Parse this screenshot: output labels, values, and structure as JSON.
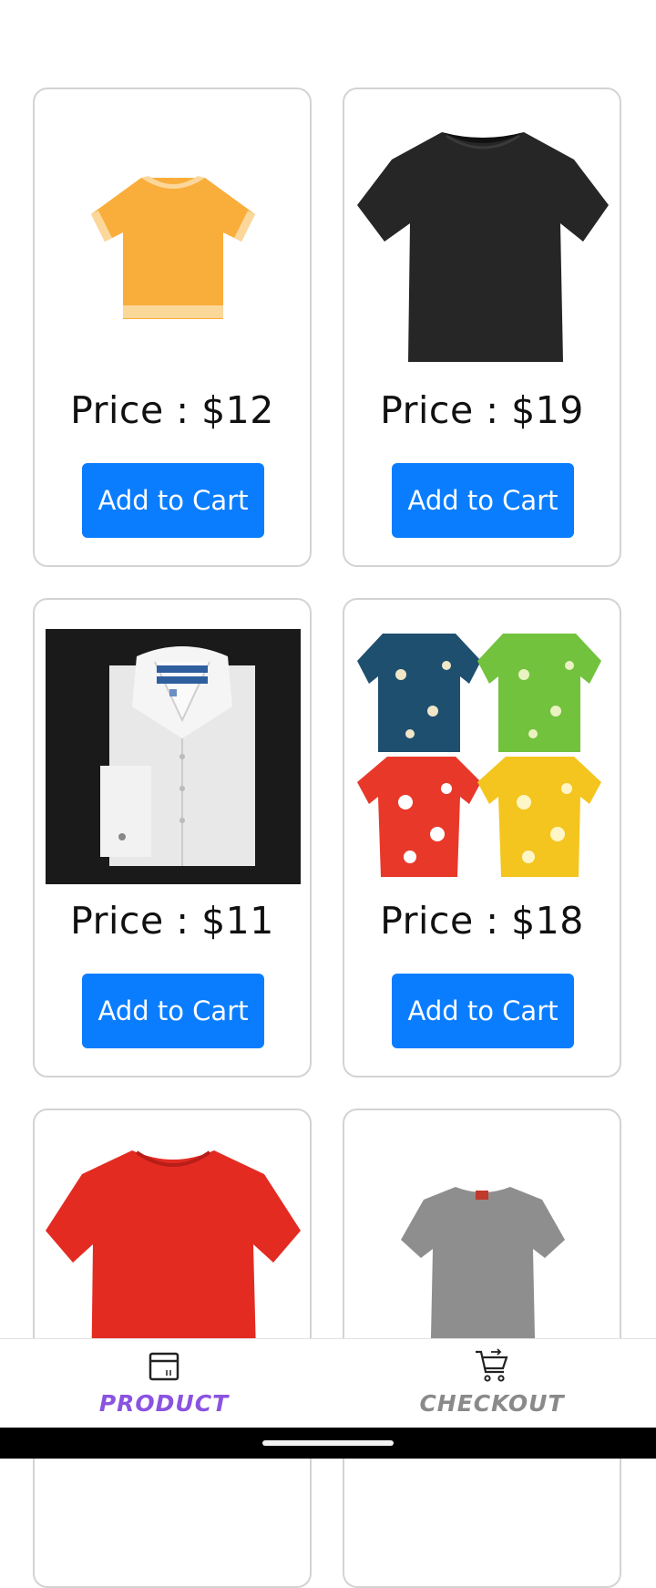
{
  "products": [
    {
      "price": "Price : $12",
      "button": "Add to Cart",
      "image": "orange-tshirt"
    },
    {
      "price": "Price : $19",
      "button": "Add to Cart",
      "image": "black-tshirt"
    },
    {
      "price": "Price : $11",
      "button": "Add to Cart",
      "image": "white-dress-shirt"
    },
    {
      "price": "Price : $18",
      "button": "Add to Cart",
      "image": "hawaiian-shirts"
    },
    {
      "price": "",
      "button": "",
      "image": "red-tshirt"
    },
    {
      "price": "",
      "button": "",
      "image": "gray-tshirt"
    }
  ],
  "nav": {
    "product_label": "PRODUCT",
    "checkout_label": "CHECKOUT",
    "product_icon": "box-icon",
    "checkout_icon": "cart-icon",
    "active_color": "#8a53e0",
    "inactive_color": "#8a8a8a"
  },
  "colors": {
    "button": "#0a7dff",
    "card_border": "#d3d3d3"
  }
}
